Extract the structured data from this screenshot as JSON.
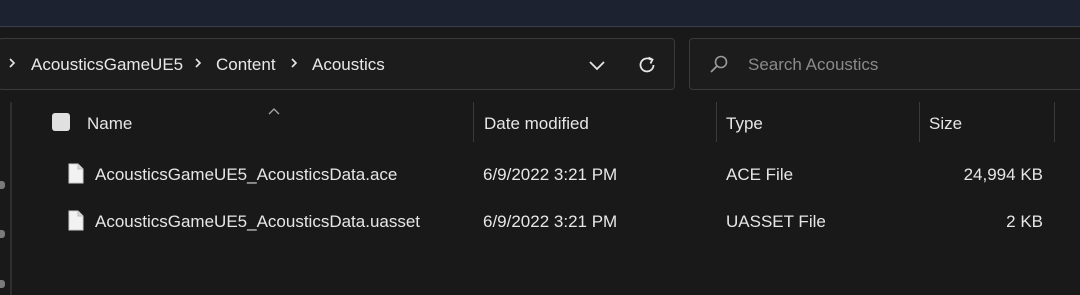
{
  "colors": {
    "background": "#191919",
    "titlebar": "#1c2230",
    "text": "#e6e6e6",
    "placeholder": "#8a8a8a"
  },
  "address_bar": {
    "breadcrumbs": [
      "AcousticsGameUE5",
      "Content",
      "Acoustics"
    ]
  },
  "search": {
    "placeholder": "Search Acoustics"
  },
  "columns": {
    "name": "Name",
    "date": "Date modified",
    "type": "Type",
    "size": "Size"
  },
  "files": [
    {
      "name": "AcousticsGameUE5_AcousticsData.ace",
      "date": "6/9/2022 3:21 PM",
      "type": "ACE File",
      "size": "24,994 KB",
      "icon": "file-icon"
    },
    {
      "name": "AcousticsGameUE5_AcousticsData.uasset",
      "date": "6/9/2022 3:21 PM",
      "type": "UASSET File",
      "size": "2 KB",
      "icon": "file-icon"
    }
  ]
}
